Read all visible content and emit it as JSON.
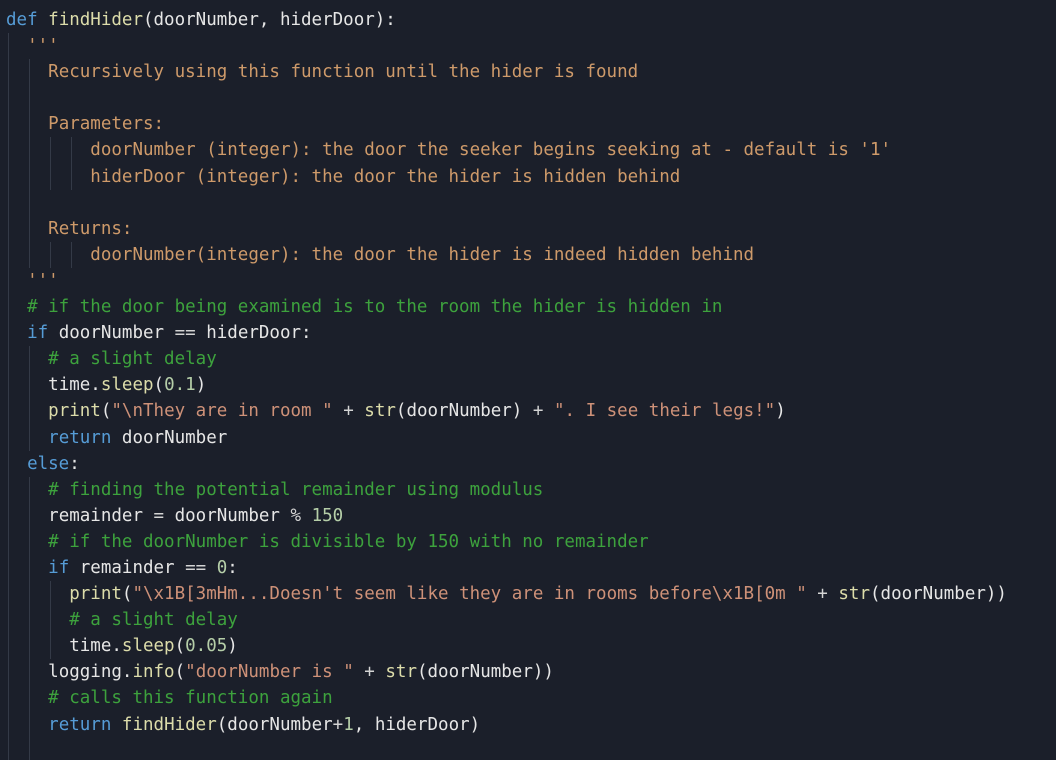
{
  "colors": {
    "background": "#1b1f2a",
    "keyword": "#569cd6",
    "function": "#dcdcaa",
    "string": "#ce9178",
    "docstring": "#ce9a6a",
    "comment": "#3da23d",
    "number": "#b5cea8",
    "text": "#e6e6e6"
  },
  "lines": [
    {
      "indent": 0,
      "tokens": [
        [
          "kw",
          "def "
        ],
        [
          "fn",
          "findHider"
        ],
        [
          "pl",
          "(doorNumber, hiderDoor):"
        ]
      ]
    },
    {
      "indent": 2,
      "tokens": [
        [
          "doc",
          "'''"
        ]
      ]
    },
    {
      "indent": 4,
      "tokens": [
        [
          "doc",
          "Recursively using this function until the hider is found"
        ]
      ]
    },
    {
      "indent": 0,
      "tokens": []
    },
    {
      "indent": 4,
      "tokens": [
        [
          "doc",
          "Parameters:"
        ]
      ]
    },
    {
      "indent": 8,
      "tokens": [
        [
          "doc",
          "doorNumber (integer): the door the seeker begins seeking at - default is '1'"
        ]
      ]
    },
    {
      "indent": 8,
      "tokens": [
        [
          "doc",
          "hiderDoor (integer): the door the hider is hidden behind"
        ]
      ]
    },
    {
      "indent": 0,
      "tokens": []
    },
    {
      "indent": 4,
      "tokens": [
        [
          "doc",
          "Returns:"
        ]
      ]
    },
    {
      "indent": 8,
      "tokens": [
        [
          "doc",
          "doorNumber(integer): the door the hider is indeed hidden behind"
        ]
      ]
    },
    {
      "indent": 2,
      "tokens": [
        [
          "doc",
          "'''"
        ]
      ]
    },
    {
      "indent": 2,
      "tokens": [
        [
          "com",
          "# if the door being examined is to the room the hider is hidden in"
        ]
      ]
    },
    {
      "indent": 2,
      "tokens": [
        [
          "kw",
          "if "
        ],
        [
          "pl",
          "doorNumber "
        ],
        [
          "op",
          "=="
        ],
        [
          "pl",
          " hiderDoor:"
        ]
      ]
    },
    {
      "indent": 4,
      "tokens": [
        [
          "com",
          "# a slight delay"
        ]
      ]
    },
    {
      "indent": 4,
      "tokens": [
        [
          "pl",
          "time."
        ],
        [
          "fn",
          "sleep"
        ],
        [
          "pl",
          "("
        ],
        [
          "num",
          "0.1"
        ],
        [
          "pl",
          ")"
        ]
      ]
    },
    {
      "indent": 4,
      "tokens": [
        [
          "fn",
          "print"
        ],
        [
          "pl",
          "("
        ],
        [
          "str",
          "\"\\nThey are in room \""
        ],
        [
          "pl",
          " "
        ],
        [
          "op",
          "+"
        ],
        [
          "pl",
          " "
        ],
        [
          "fn",
          "str"
        ],
        [
          "pl",
          "(doorNumber) "
        ],
        [
          "op",
          "+"
        ],
        [
          "pl",
          " "
        ],
        [
          "str",
          "\". I see their legs!\""
        ],
        [
          "pl",
          ")"
        ]
      ]
    },
    {
      "indent": 4,
      "tokens": [
        [
          "kw",
          "return "
        ],
        [
          "pl",
          "doorNumber"
        ]
      ]
    },
    {
      "indent": 2,
      "tokens": [
        [
          "kw",
          "else"
        ],
        [
          "pl",
          ":"
        ]
      ]
    },
    {
      "indent": 4,
      "tokens": [
        [
          "com",
          "# finding the potential remainder using modulus"
        ]
      ]
    },
    {
      "indent": 4,
      "tokens": [
        [
          "pl",
          "remainder "
        ],
        [
          "op",
          "="
        ],
        [
          "pl",
          " doorNumber "
        ],
        [
          "op",
          "%"
        ],
        [
          "pl",
          " "
        ],
        [
          "num",
          "150"
        ]
      ]
    },
    {
      "indent": 4,
      "tokens": [
        [
          "com",
          "# if the doorNumber is divisible by 150 with no remainder"
        ]
      ]
    },
    {
      "indent": 4,
      "tokens": [
        [
          "kw",
          "if "
        ],
        [
          "pl",
          "remainder "
        ],
        [
          "op",
          "=="
        ],
        [
          "pl",
          " "
        ],
        [
          "num",
          "0"
        ],
        [
          "pl",
          ":"
        ]
      ]
    },
    {
      "indent": 6,
      "tokens": [
        [
          "fn",
          "print"
        ],
        [
          "pl",
          "("
        ],
        [
          "str",
          "\"\\x1B[3mHm...Doesn't seem like they are in rooms before\\x1B[0m \""
        ],
        [
          "pl",
          " "
        ],
        [
          "op",
          "+"
        ],
        [
          "pl",
          " "
        ],
        [
          "fn",
          "str"
        ],
        [
          "pl",
          "(doorNumber))"
        ]
      ]
    },
    {
      "indent": 6,
      "tokens": [
        [
          "com",
          "# a slight delay"
        ]
      ]
    },
    {
      "indent": 6,
      "tokens": [
        [
          "pl",
          "time."
        ],
        [
          "fn",
          "sleep"
        ],
        [
          "pl",
          "("
        ],
        [
          "num",
          "0.05"
        ],
        [
          "pl",
          ")"
        ]
      ]
    },
    {
      "indent": 4,
      "tokens": [
        [
          "pl",
          "logging."
        ],
        [
          "fn",
          "info"
        ],
        [
          "pl",
          "("
        ],
        [
          "str",
          "\"doorNumber is \""
        ],
        [
          "pl",
          " "
        ],
        [
          "op",
          "+"
        ],
        [
          "pl",
          " "
        ],
        [
          "fn",
          "str"
        ],
        [
          "pl",
          "(doorNumber))"
        ]
      ]
    },
    {
      "indent": 4,
      "tokens": [
        [
          "com",
          "# calls this function again"
        ]
      ]
    },
    {
      "indent": 4,
      "tokens": [
        [
          "kw",
          "return "
        ],
        [
          "fn",
          "findHider"
        ],
        [
          "pl",
          "(doorNumber"
        ],
        [
          "op",
          "+"
        ],
        [
          "num",
          "1"
        ],
        [
          "pl",
          ", hiderDoor)"
        ]
      ]
    },
    {
      "indent": 0,
      "tokens": []
    }
  ]
}
